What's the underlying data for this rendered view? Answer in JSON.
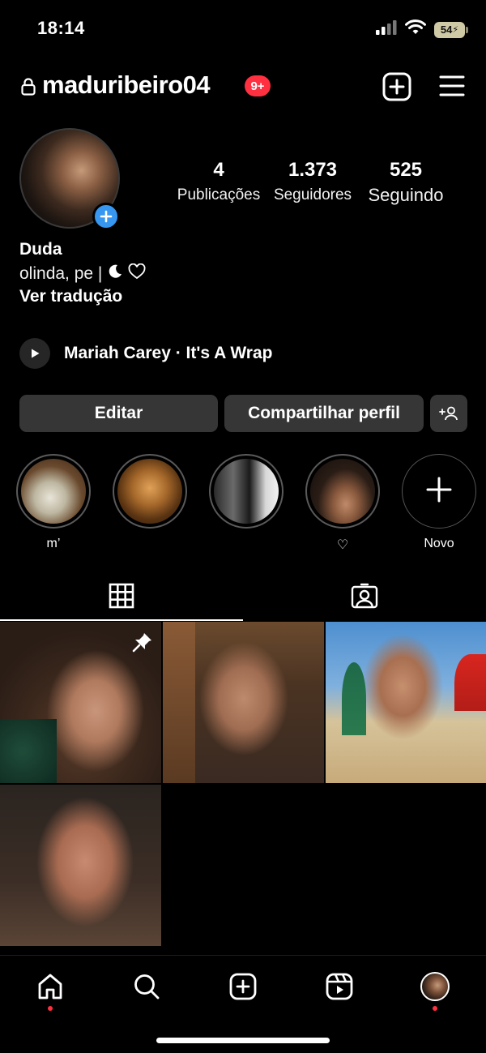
{
  "status_bar": {
    "time": "18:14",
    "battery": "54"
  },
  "header": {
    "username": "maduribeiro04",
    "notification_badge": "9+"
  },
  "profile": {
    "stats": [
      {
        "value": "4",
        "label": "Publicações"
      },
      {
        "value": "1.373",
        "label": "Seguidores"
      },
      {
        "value": "525",
        "label": "Seguindo"
      }
    ],
    "name": "Duda",
    "bio": "olinda, pe |",
    "see_translation": "Ver tradução",
    "music": "Mariah Carey · It's A Wrap"
  },
  "buttons": {
    "edit": "Editar",
    "share": "Compartilhar perfil"
  },
  "highlights": [
    {
      "label": "m’"
    },
    {
      "label": ""
    },
    {
      "label": ""
    },
    {
      "label": "♡"
    },
    {
      "label": "Novo"
    }
  ],
  "icons": {
    "lock": "lock-icon",
    "new_post": "plus-square-icon",
    "menu": "hamburger-icon",
    "grid": "grid-icon",
    "tagged": "tagged-icon",
    "home": "home-icon",
    "search": "search-icon",
    "create": "create-icon",
    "reels": "reels-icon",
    "pin": "pin-icon",
    "play": "play-icon",
    "discover": "add-person-icon"
  },
  "colors": {
    "badge": "#ff3040",
    "accent_blue": "#3797f0",
    "button_bg": "#363636"
  }
}
